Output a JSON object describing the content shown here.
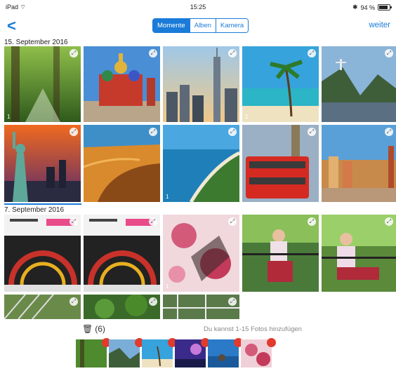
{
  "status": {
    "device": "iPad",
    "time": "15:25",
    "battery": "94 %"
  },
  "nav": {
    "back": "<",
    "segments": [
      "Momente",
      "Alben",
      "Kamera"
    ],
    "active_segment": "Momente",
    "next": "weiter"
  },
  "sections": [
    {
      "title": "15. September 2016"
    },
    {
      "title": "7. September 2016"
    }
  ],
  "tiles": [
    {
      "badge": "1"
    },
    {
      "badge": ""
    },
    {
      "badge": ""
    },
    {
      "badge": "1"
    },
    {
      "badge": ""
    },
    {
      "badge": ""
    },
    {
      "badge": ""
    },
    {
      "badge": "1"
    },
    {
      "badge": ""
    },
    {
      "badge": ""
    },
    {
      "badge": ""
    },
    {
      "badge": ""
    },
    {
      "badge": "1"
    },
    {
      "badge": ""
    },
    {
      "badge": ""
    },
    {
      "badge": ""
    },
    {
      "badge": ""
    },
    {
      "badge": ""
    }
  ],
  "bottom": {
    "trash_count": "(6)",
    "hint": "Du kannst 1-15 Fotos hinzufügen"
  },
  "colors": {
    "accent": "#1a7bd8",
    "selection_dot": "#e23a2c"
  }
}
